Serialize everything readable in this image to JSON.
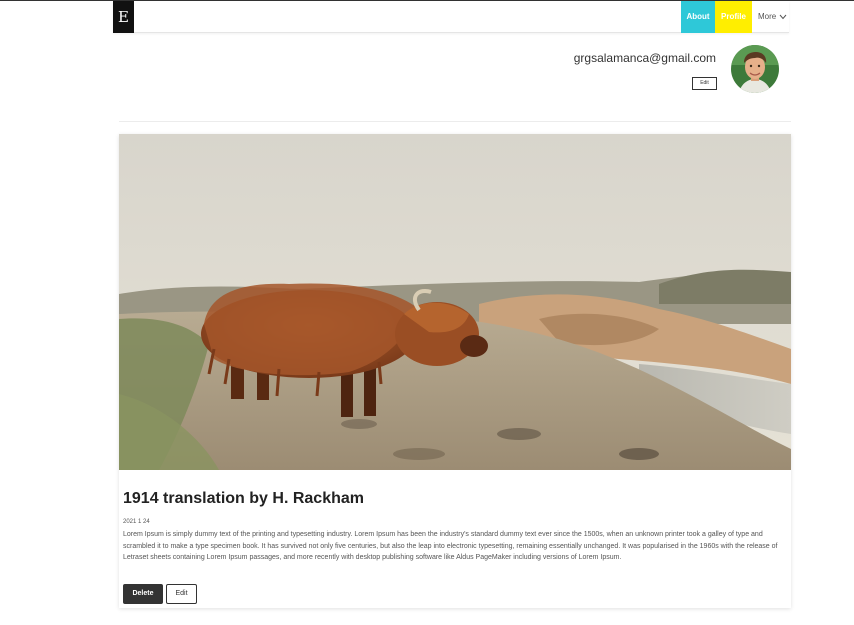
{
  "navbar": {
    "brand": "E",
    "links": [
      {
        "label": "About",
        "color": "#2ec8d8"
      },
      {
        "label": "Profile",
        "color": "#ffee00"
      },
      {
        "label": "More"
      }
    ]
  },
  "profile": {
    "email": "grgsalamanca@gmail.com",
    "edit_label": "Edit"
  },
  "post": {
    "title": "1914 translation by H. Rackham",
    "date": "2021 1 24",
    "body": "Lorem Ipsum is simply dummy text of the printing and typesetting industry. Lorem Ipsum has been the industry's standard dummy text ever since the 1500s, when an unknown printer took a galley of type and scrambled it to make a type specimen book. It has survived not only five centuries, but also the leap into electronic typesetting, remaining essentially unchanged. It was popularised in the 1960s with the release of Letraset sheets containing Lorem Ipsum passages, and more recently with desktop publishing software like Aldus PageMaker including versions of Lorem Ipsum.",
    "delete_label": "Delete",
    "edit_label": "Edit"
  },
  "icons": {
    "more": "chevron-down-icon"
  }
}
